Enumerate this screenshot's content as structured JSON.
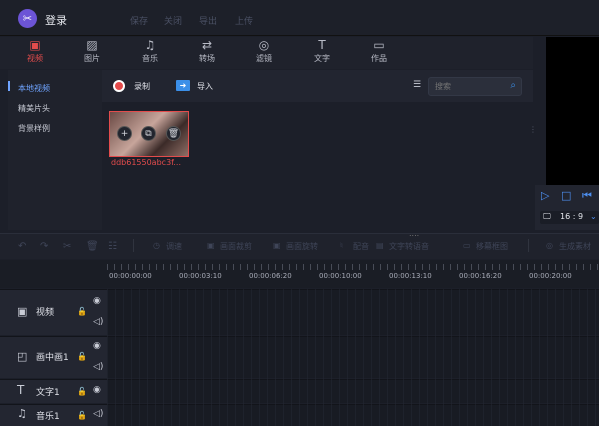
{
  "app": {
    "login": "登录"
  },
  "top_menu": [
    "保存",
    "关闭",
    "导出",
    "上传"
  ],
  "categories": [
    {
      "label": "视频",
      "icon": "film-icon",
      "active": true
    },
    {
      "label": "图片",
      "icon": "image-icon"
    },
    {
      "label": "音乐",
      "icon": "music-icon"
    },
    {
      "label": "转场",
      "icon": "transition-icon"
    },
    {
      "label": "滤镜",
      "icon": "filter-icon"
    },
    {
      "label": "文字",
      "icon": "text-icon"
    },
    {
      "label": "作品",
      "icon": "folder-icon"
    }
  ],
  "sidebar": [
    "本地视频",
    "精美片头",
    "背景样例"
  ],
  "toolbar": {
    "record": "录制",
    "import": "导入",
    "search_placeholder": "搜索"
  },
  "media": {
    "filename": "ddb61550abc3f..."
  },
  "preview": {
    "ratio": "16 : 9"
  },
  "edit_tools": [
    "调速",
    "画面裁剪",
    "画面旋转",
    "配音",
    "文字转语音",
    "移幕框图",
    "生成素材"
  ],
  "timeline": {
    "ticks": [
      "00:00:00:00",
      "00:00:03:10",
      "00:00:06:20",
      "00:00:10:00",
      "00:00:13:10",
      "00:00:16:20",
      "00:00:20:00"
    ],
    "tracks": [
      "视频",
      "画中画1",
      "文字1",
      "音乐1"
    ]
  }
}
